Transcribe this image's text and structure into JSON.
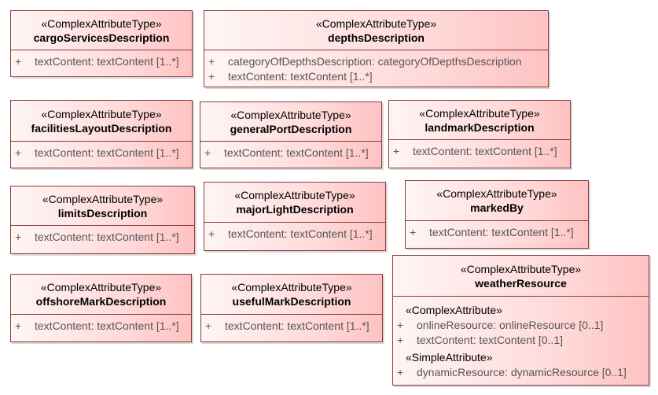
{
  "classes": [
    {
      "stereotype": "«ComplexAttributeType»",
      "name": "cargoServicesDescription",
      "attributes": [
        {
          "vis": "+",
          "text": "textContent: textContent [1..*]"
        }
      ]
    },
    {
      "stereotype": "«ComplexAttributeType»",
      "name": "depthsDescription",
      "attributes": [
        {
          "vis": "+",
          "text": "categoryOfDepthsDescription: categoryOfDepthsDescription"
        },
        {
          "vis": "+",
          "text": "textContent: textContent [1..*]"
        }
      ]
    },
    {
      "stereotype": "«ComplexAttributeType»",
      "name": "facilitiesLayoutDescription",
      "attributes": [
        {
          "vis": "+",
          "text": "textContent: textContent [1..*]"
        }
      ]
    },
    {
      "stereotype": "«ComplexAttributeType»",
      "name": "generalPortDescription",
      "attributes": [
        {
          "vis": "+",
          "text": "textContent: textContent [1..*]"
        }
      ]
    },
    {
      "stereotype": "«ComplexAttributeType»",
      "name": "landmarkDescription",
      "attributes": [
        {
          "vis": "+",
          "text": "textContent: textContent [1..*]"
        }
      ]
    },
    {
      "stereotype": "«ComplexAttributeType»",
      "name": "limitsDescription",
      "attributes": [
        {
          "vis": "+",
          "text": "textContent: textContent [1..*]"
        }
      ]
    },
    {
      "stereotype": "«ComplexAttributeType»",
      "name": "majorLightDescription",
      "attributes": [
        {
          "vis": "+",
          "text": "textContent: textContent [1..*]"
        }
      ]
    },
    {
      "stereotype": "«ComplexAttributeType»",
      "name": "markedBy",
      "attributes": [
        {
          "vis": "+",
          "text": "textContent: textContent [1..*]"
        }
      ]
    },
    {
      "stereotype": "«ComplexAttributeType»",
      "name": "offshoreMarkDescription",
      "attributes": [
        {
          "vis": "+",
          "text": "textContent: textContent [1..*]"
        }
      ]
    },
    {
      "stereotype": "«ComplexAttributeType»",
      "name": "usefulMarkDescription",
      "attributes": [
        {
          "vis": "+",
          "text": "textContent: textContent [1..*]"
        }
      ]
    },
    {
      "stereotype": "«ComplexAttributeType»",
      "name": "weatherResource",
      "groups": [
        {
          "stereotype": "«ComplexAttribute»",
          "attributes": [
            {
              "vis": "+",
              "text": "onlineResource: onlineResource [0..1]"
            },
            {
              "vis": "+",
              "text": "textContent: textContent [0..1]"
            }
          ]
        },
        {
          "stereotype": "«SimpleAttribute»",
          "attributes": [
            {
              "vis": "+",
              "text": "dynamicResource: dynamicResource [0..1]"
            }
          ]
        }
      ]
    }
  ]
}
